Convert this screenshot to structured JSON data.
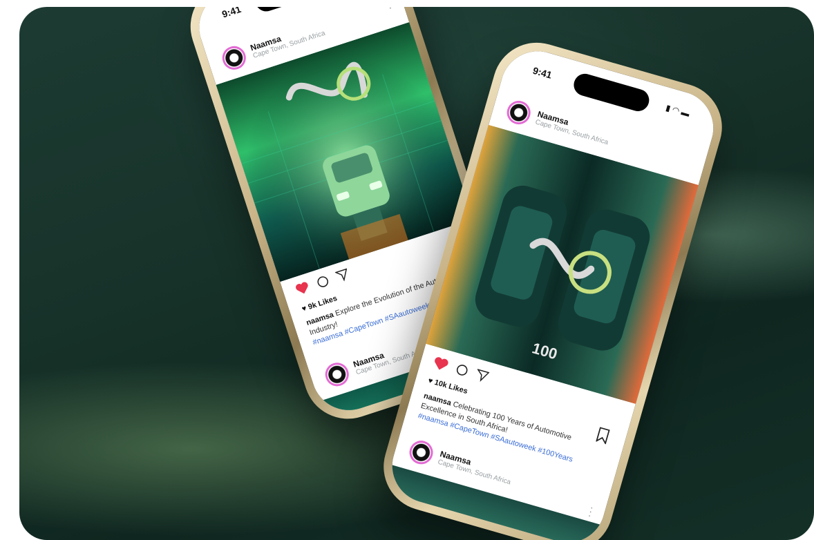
{
  "phone_left": {
    "status_time": "9:41",
    "post": {
      "username": "Naamsa",
      "location": "Cape Town, South Africa",
      "likes": "9k Likes",
      "caption_user": "naamsa",
      "caption_text": "Explore the Evolution of the Automotive Industry!",
      "hashtags": "#naamsa #CapeTown #SAautoweek"
    },
    "next_post": {
      "username": "Naamsa",
      "location": "Cape Town, South Africa"
    }
  },
  "phone_right": {
    "status_time": "9:41",
    "post": {
      "username": "Naamsa",
      "location": "Cape Town, South Africa",
      "likes": "10k Likes",
      "caption_user": "naamsa",
      "caption_text": "Celebrating 100 Years of Automotive Excellence in South Africa!",
      "hashtags": "#naamsa #CapeTown #SAautoweek #100Years",
      "brand_mark": "100"
    },
    "next_post": {
      "username": "Naamsa",
      "location": "Cape Town, South Africa"
    }
  },
  "colors": {
    "heart": "#e8344e",
    "avatar_ring": "#e36bd4",
    "hashtag": "#3b6ed6",
    "phone_frame": "#c9b488"
  },
  "icons": [
    "heart-icon",
    "comment-icon",
    "share-icon",
    "bookmark-icon",
    "more-icon",
    "signal-icon",
    "wifi-icon",
    "battery-icon"
  ]
}
